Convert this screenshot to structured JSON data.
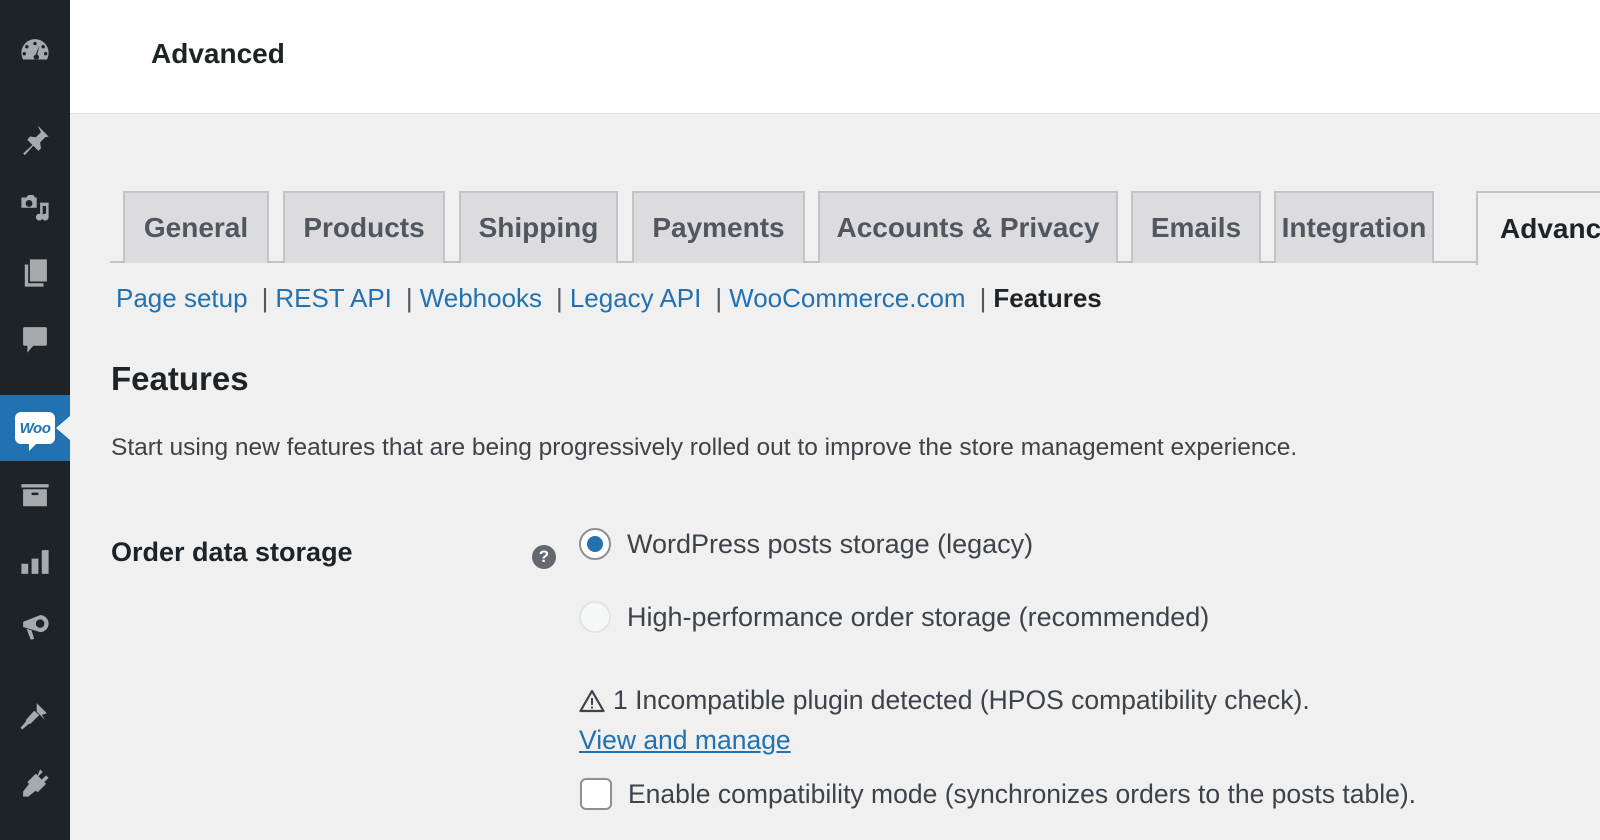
{
  "sidebar": {
    "items": [
      {
        "icon": "dashboard-icon",
        "label": "Dashboard"
      },
      {
        "icon": "pin-icon",
        "label": "Posts"
      },
      {
        "icon": "media-icon",
        "label": "Media"
      },
      {
        "icon": "pages-icon",
        "label": "Pages"
      },
      {
        "icon": "comments-icon",
        "label": "Comments"
      },
      {
        "icon": "woocommerce-icon",
        "label": "WooCommerce",
        "badge": "Woo",
        "active": true
      },
      {
        "icon": "archive-icon",
        "label": "Products"
      },
      {
        "icon": "analytics-icon",
        "label": "Analytics"
      },
      {
        "icon": "megaphone-icon",
        "label": "Marketing"
      },
      {
        "icon": "paintbrush-icon",
        "label": "Appearance"
      },
      {
        "icon": "plugin-icon",
        "label": "Plugins"
      }
    ]
  },
  "header": {
    "title": "Advanced"
  },
  "tabs": [
    {
      "label": "General"
    },
    {
      "label": "Products"
    },
    {
      "label": "Shipping"
    },
    {
      "label": "Payments"
    },
    {
      "label": "Accounts & Privacy"
    },
    {
      "label": "Emails"
    },
    {
      "label": "Integration"
    },
    {
      "label": "Advanced",
      "active": true
    }
  ],
  "subnav": {
    "links": [
      "Page setup",
      "REST API",
      "Webhooks",
      "Legacy API",
      "WooCommerce.com"
    ],
    "separator": "|",
    "current": "Features"
  },
  "section": {
    "title": "Features",
    "description": "Start using new features that are being progressively rolled out to improve the store management experience."
  },
  "order_storage": {
    "label": "Order data storage",
    "help_icon": "?",
    "options": [
      {
        "label": "WordPress posts storage (legacy)",
        "checked": true,
        "disabled": false
      },
      {
        "label": "High-performance order storage (recommended)",
        "checked": false,
        "disabled": true
      }
    ],
    "warning": "1 Incompatible plugin detected (HPOS compatibility check).",
    "warning_icon": "warning-triangle-icon",
    "manage_link": "View and manage",
    "compat_mode": {
      "label": "Enable compatibility mode (synchronizes orders to the posts table).",
      "checked": false
    }
  },
  "colors": {
    "sidebar_bg": "#1d2327",
    "accent": "#2271b1",
    "page_bg": "#f0f0f1"
  }
}
